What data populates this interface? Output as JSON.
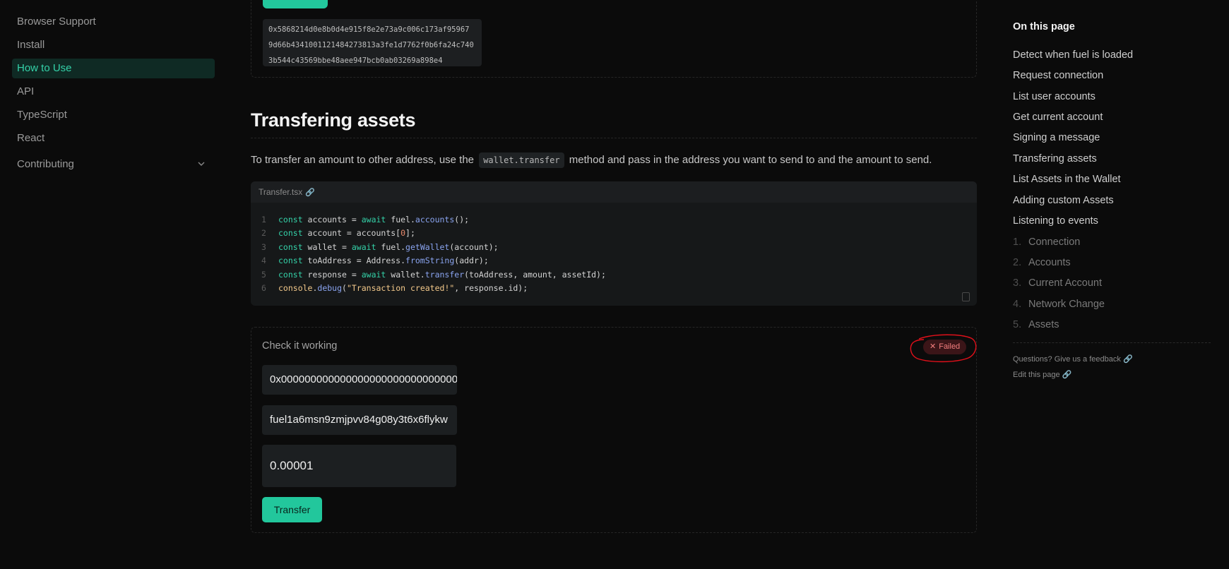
{
  "sidebar": {
    "items": [
      {
        "label": "Browser Support"
      },
      {
        "label": "Install"
      },
      {
        "label": "How to Use"
      },
      {
        "label": "API"
      },
      {
        "label": "TypeScript"
      },
      {
        "label": "React"
      },
      {
        "label": "Contributing"
      }
    ]
  },
  "signature": {
    "lines": [
      "0x5868214d0e8b0d4e915f8e2e73a9c006c173af95967",
      "9d66b4341001121484273813a3fe1d7762f0b6fa24c740",
      "3b544c43569bbe48aee947bcb0ab03269a898e4"
    ]
  },
  "section": {
    "title": "Transfering assets",
    "para_before": "To transfer an amount to other address, use the",
    "inline_code": "wallet.transfer",
    "para_after": "method and pass in the address you want to send to and the amount to send."
  },
  "code": {
    "filename": "Transfer.tsx",
    "line_numbers": [
      "1",
      "2",
      "3",
      "4",
      "5",
      "6"
    ],
    "line1": {
      "kw1": "const",
      "t1": " accounts = ",
      "kw2": "await",
      "t2": " fuel.",
      "fn": "accounts",
      "t3": "();"
    },
    "line2": {
      "kw1": "const",
      "t1": " account = accounts[",
      "num": "0",
      "t2": "];"
    },
    "line3": {
      "kw1": "const",
      "t1": " wallet = ",
      "kw2": "await",
      "t2": " fuel.",
      "fn": "getWallet",
      "t3": "(account);"
    },
    "line4": {
      "kw1": "const",
      "t1": " toAddress = Address.",
      "fn": "fromString",
      "t2": "(addr);"
    },
    "line5": {
      "kw1": "const",
      "t1": " response = ",
      "kw2": "await",
      "t2": " wallet.",
      "fn": "transfer",
      "t3": "(toAddress, amount, assetId);"
    },
    "line6": {
      "obj": "console",
      "t1": ".",
      "fn": "debug",
      "t2": "(",
      "str": "\"Transaction created!\"",
      "t3": ", response.id);"
    }
  },
  "demo": {
    "title": "Check it working",
    "badge": "Failed",
    "asset_id_value": "0x000000000000000000000000000000",
    "address_value": "fuel1a6msn9zmjpvv84g08y3t6x6flykw",
    "amount_value": "0.00001",
    "button_label": "Transfer"
  },
  "toc": {
    "title": "On this page",
    "items": [
      "Detect when fuel is loaded",
      "Request connection",
      "List user accounts",
      "Get current account",
      "Signing a message",
      "Transfering assets",
      "List Assets in the Wallet",
      "Adding custom Assets",
      "Listening to events"
    ],
    "sub_items": [
      {
        "num": "1.",
        "label": "Connection"
      },
      {
        "num": "2.",
        "label": "Accounts"
      },
      {
        "num": "3.",
        "label": "Current Account"
      },
      {
        "num": "4.",
        "label": "Network Change"
      },
      {
        "num": "5.",
        "label": "Assets"
      }
    ],
    "feedback": "Questions? Give us a feedback",
    "edit": "Edit this page"
  },
  "colors": {
    "accent": "#22c79c",
    "background": "#0b0b0b",
    "failed": "#f47f7f",
    "annotation": "#e0101a"
  }
}
